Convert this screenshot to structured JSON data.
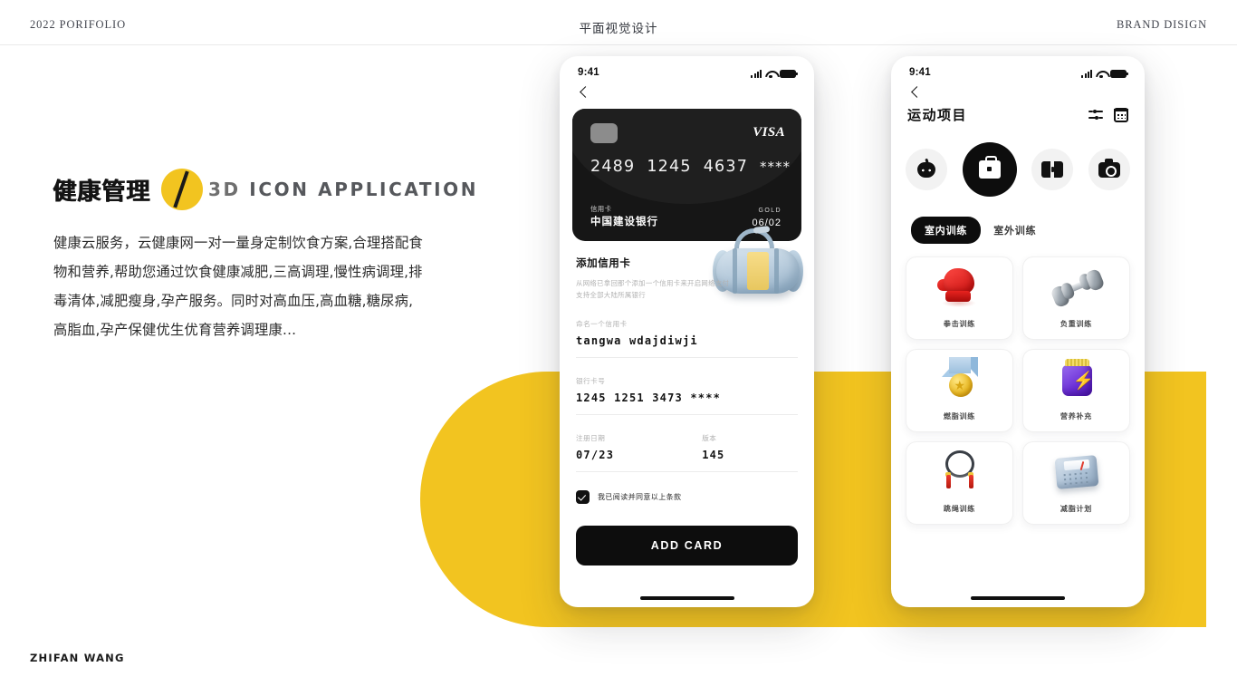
{
  "header": {
    "left": "2022 PORIFOLIO",
    "center": "平面视觉设计",
    "right": "BRAND DISIGN"
  },
  "hero": {
    "title_cn": "健康管理",
    "title_en_lead": "3D",
    "title_en_rest": " ICON  APPLICATION",
    "body": "健康云服务，云健康网一对一量身定制饮食方案,合理搭配食物和营养,帮助您通过饮食健康减肥,三高调理,慢性病调理,排毒清体,减肥瘦身,孕产服务。同时对高血压,高血糖,糖尿病,高脂血,孕产保健优生优育营养调理康..."
  },
  "footer": {
    "name": "ZHIFAN WANG"
  },
  "colors": {
    "accent": "#f2c420",
    "ink": "#0d0d0d"
  },
  "phone1": {
    "status": {
      "time": "9:41"
    },
    "card": {
      "brand": "VISA",
      "number_groups": [
        "2489",
        "1245",
        "4637"
      ],
      "number_masked": "****",
      "type_label": "信用卡",
      "bank": "中国建设银行",
      "tier": "GOLD",
      "expiry": "06/02"
    },
    "section": {
      "title": "添加信用卡",
      "sub_line1": "从网络已拿回那个添加一个信用卡来开启网络支付",
      "sub_line2": "支持全部大陆所属银行"
    },
    "fields": [
      {
        "label": "命名一个信用卡",
        "value": "tangwa wdajdiwji"
      },
      {
        "label": "银行卡号",
        "value": "1245 1251 3473 ****"
      },
      {
        "label": "注册日期",
        "value": "07/23"
      },
      {
        "label": "版本",
        "value": "145"
      }
    ],
    "agree_text": "我已阅读并同意以上条款",
    "submit_label": "ADD CARD"
  },
  "phone2": {
    "status": {
      "time": "9:41"
    },
    "title": "运动项目",
    "actions": [
      {
        "name": "filter-icon"
      },
      {
        "name": "calendar-icon"
      }
    ],
    "categories": [
      {
        "icon": "gamepad-icon",
        "active": false
      },
      {
        "icon": "briefcase-icon",
        "active": true
      },
      {
        "icon": "ticket-icon",
        "active": false
      },
      {
        "icon": "camera-icon",
        "active": false
      }
    ],
    "tabs": [
      {
        "label": "室内训练",
        "active": true
      },
      {
        "label": "室外训练",
        "active": false
      }
    ],
    "items": [
      {
        "label": "拳击训练",
        "art": "boxing-glove-icon"
      },
      {
        "label": "负重训练",
        "art": "dumbbell-icon"
      },
      {
        "label": "燃脂训练",
        "art": "medal-icon"
      },
      {
        "label": "营养补充",
        "art": "supplement-jar-icon"
      },
      {
        "label": "跳绳训练",
        "art": "jump-rope-icon"
      },
      {
        "label": "减脂计划",
        "art": "weight-scale-icon"
      }
    ]
  }
}
